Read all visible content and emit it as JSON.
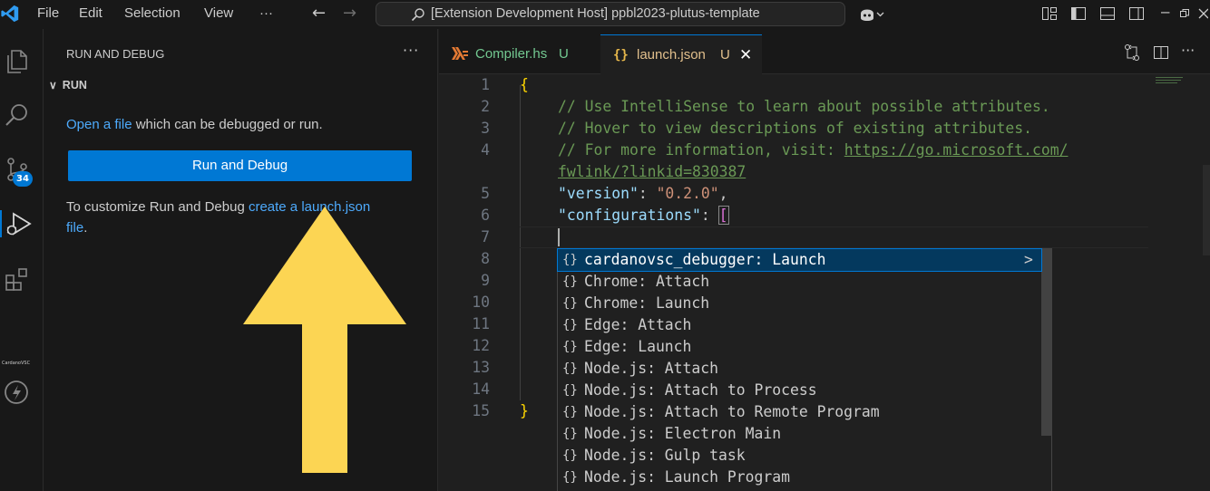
{
  "titlebar": {
    "menu": [
      "File",
      "Edit",
      "Selection",
      "View"
    ],
    "more": "···",
    "command_center": "[Extension Development Host] ppbl2023-plutus-template",
    "min": "–"
  },
  "activity": {
    "scm_badge": "34",
    "cardano_label": "CardanoVSC"
  },
  "sidebar": {
    "title": "RUN AND DEBUG",
    "more": "···",
    "section": "RUN",
    "open_link": "Open a file",
    "open_rest": " which can be debugged or run.",
    "button_label": "Run and Debug",
    "customize_text": "To customize Run and Debug ",
    "customize_link": "create a launch.json",
    "file_link": "file",
    "period": "."
  },
  "tabs": [
    {
      "name": "Compiler.hs",
      "status": "U"
    },
    {
      "name": "launch.json",
      "status": "U",
      "close": "✕"
    }
  ],
  "editor": {
    "line_numbers": [
      "1",
      "2",
      "3",
      "4",
      "",
      "5",
      "6",
      "7",
      "8",
      "9",
      "10",
      "11",
      "12",
      "13",
      "14",
      "15"
    ],
    "line1": "{",
    "comment1": "// Use IntelliSense to learn about possible attributes.",
    "comment2": "// Hover to view descriptions of existing attributes.",
    "comment3_prefix": "// For more information, visit: ",
    "comment3_link": "https://go.microsoft.com/",
    "comment3_link2": "fwlink/?linkid=830387",
    "version_key": "\"version\"",
    "colon": ": ",
    "version_val": "\"0.2.0\"",
    "comma": ",",
    "config_key": "\"configurations\"",
    "bracket": "[",
    "close_brace": "}"
  },
  "suggestions": {
    "icon": "{}",
    "items": [
      "cardanovsc_debugger: Launch",
      "Chrome: Attach",
      "Chrome: Launch",
      "Edge: Attach",
      "Edge: Launch",
      "Node.js: Attach",
      "Node.js: Attach to Process",
      "Node.js: Attach to Remote Program",
      "Node.js: Electron Main",
      "Node.js: Gulp task",
      "Node.js: Launch Program"
    ],
    "arrow": ">"
  },
  "colors": {
    "accent": "#0078d4",
    "overlay_arrow": "#fcd553"
  }
}
